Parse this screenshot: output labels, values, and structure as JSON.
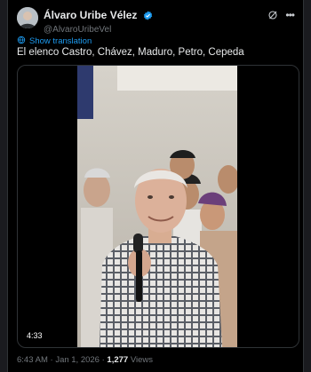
{
  "tweet": {
    "author_name": "Álvaro Uribe Vélez",
    "handle": "@AlvaroUribeVel",
    "translate_label": "Show translation",
    "text": "El elenco Castro, Chávez, Maduro, Petro, Cepeda",
    "video_duration": "4:33",
    "time": "6:43 AM",
    "separator": "·",
    "date": "Jan 1, 2026",
    "views_count": "1,277",
    "views_label": "Views"
  },
  "icons": {
    "verified": "verified-badge-icon",
    "grok": "grok-icon",
    "more": "more-icon",
    "translate": "translate-icon"
  },
  "colors": {
    "accent": "#1d9bf0",
    "background": "#000000",
    "muted": "#71767b"
  }
}
